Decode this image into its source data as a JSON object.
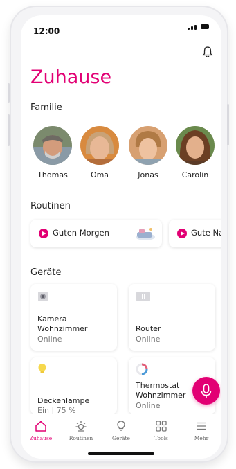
{
  "status": {
    "time": "12:00"
  },
  "header": {
    "title": "Zuhause",
    "bell": "bell-icon"
  },
  "family": {
    "heading": "Familie",
    "members": [
      {
        "name": "Thomas"
      },
      {
        "name": "Oma"
      },
      {
        "name": "Jonas"
      },
      {
        "name": "Carolin"
      }
    ]
  },
  "routines": {
    "heading": "Routinen",
    "items": [
      {
        "label": "Guten Morgen"
      },
      {
        "label": "Gute Na"
      }
    ]
  },
  "devices": {
    "heading": "Geräte",
    "items": [
      {
        "name_line1": "Kamera",
        "name_line2": "Wohnzimmer",
        "status": "Online",
        "icon": "camera-icon"
      },
      {
        "name_line1": "Router",
        "name_line2": "",
        "status": "Online",
        "icon": "router-icon"
      },
      {
        "name_line1": "Deckenlampe",
        "name_line2": "",
        "status": "Ein | 75 %",
        "icon": "lightbulb-icon"
      },
      {
        "name_line1": "Thermostat",
        "name_line2": "Wohnzimmer",
        "status": "Online",
        "icon": "thermostat-icon"
      }
    ]
  },
  "tabbar": {
    "tabs": [
      {
        "label": "Zuhause",
        "icon": "home-icon",
        "active": true
      },
      {
        "label": "Routinen",
        "icon": "sun-icon",
        "active": false
      },
      {
        "label": "Geräte",
        "icon": "lightbulb-icon",
        "active": false
      },
      {
        "label": "Tools",
        "icon": "grid-icon",
        "active": false
      },
      {
        "label": "Mehr",
        "icon": "menu-icon",
        "active": false
      }
    ]
  },
  "colors": {
    "accent": "#e20074",
    "text": "#222222",
    "muted": "#777777"
  }
}
